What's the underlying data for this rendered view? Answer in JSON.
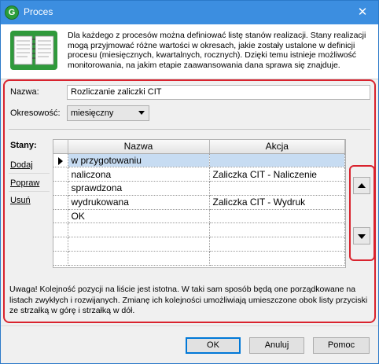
{
  "window": {
    "title": "Proces",
    "app_icon_glyph": "G",
    "close_glyph": "✕",
    "title_color": "#3c8ee0"
  },
  "header": {
    "icon": "book-icon",
    "text": "Dla każdego z procesów można definiować listę stanów realizacji. Stany realizacji mogą przyjmować różne wartości w okresach, jakie zostały ustalone w definicji procesu (miesięcznych, kwartalnych, rocznych). Dzięki temu istnieje możliwość monitorowania, na jakim etapie zaawansowania dana sprawa się znajduje."
  },
  "form": {
    "name_label": "Nazwa:",
    "name_value": "Rozliczanie zaliczki CIT",
    "period_label": "Okresowość:",
    "period_value": "miesięczny"
  },
  "states": {
    "label": "Stany:",
    "links": [
      "Dodaj",
      "Popraw",
      "Usuń"
    ],
    "columns": [
      "Nazwa",
      "Akcja"
    ],
    "rows": [
      {
        "name": "w przygotowaniu",
        "action": ""
      },
      {
        "name": "naliczona",
        "action": "Zaliczka CIT - Naliczenie"
      },
      {
        "name": "sprawdzona",
        "action": ""
      },
      {
        "name": "wydrukowana",
        "action": "Zaliczka CIT - Wydruk"
      },
      {
        "name": "OK",
        "action": ""
      },
      {
        "name": "",
        "action": ""
      },
      {
        "name": "",
        "action": ""
      },
      {
        "name": "",
        "action": ""
      }
    ],
    "selected_row": 0
  },
  "note": "Uwaga! Kolejność pozycji na liście jest istotna. W taki sam sposób będą one porządkowane na listach zwykłych i rozwijanych. Zmianę ich kolejności umożliwiają umieszczone obok listy przyciski ze strzałką w górę i strzałką w dół.",
  "buttons": {
    "ok": "OK",
    "cancel": "Anuluj",
    "help": "Pomoc"
  },
  "accent_color": "#d9232e"
}
